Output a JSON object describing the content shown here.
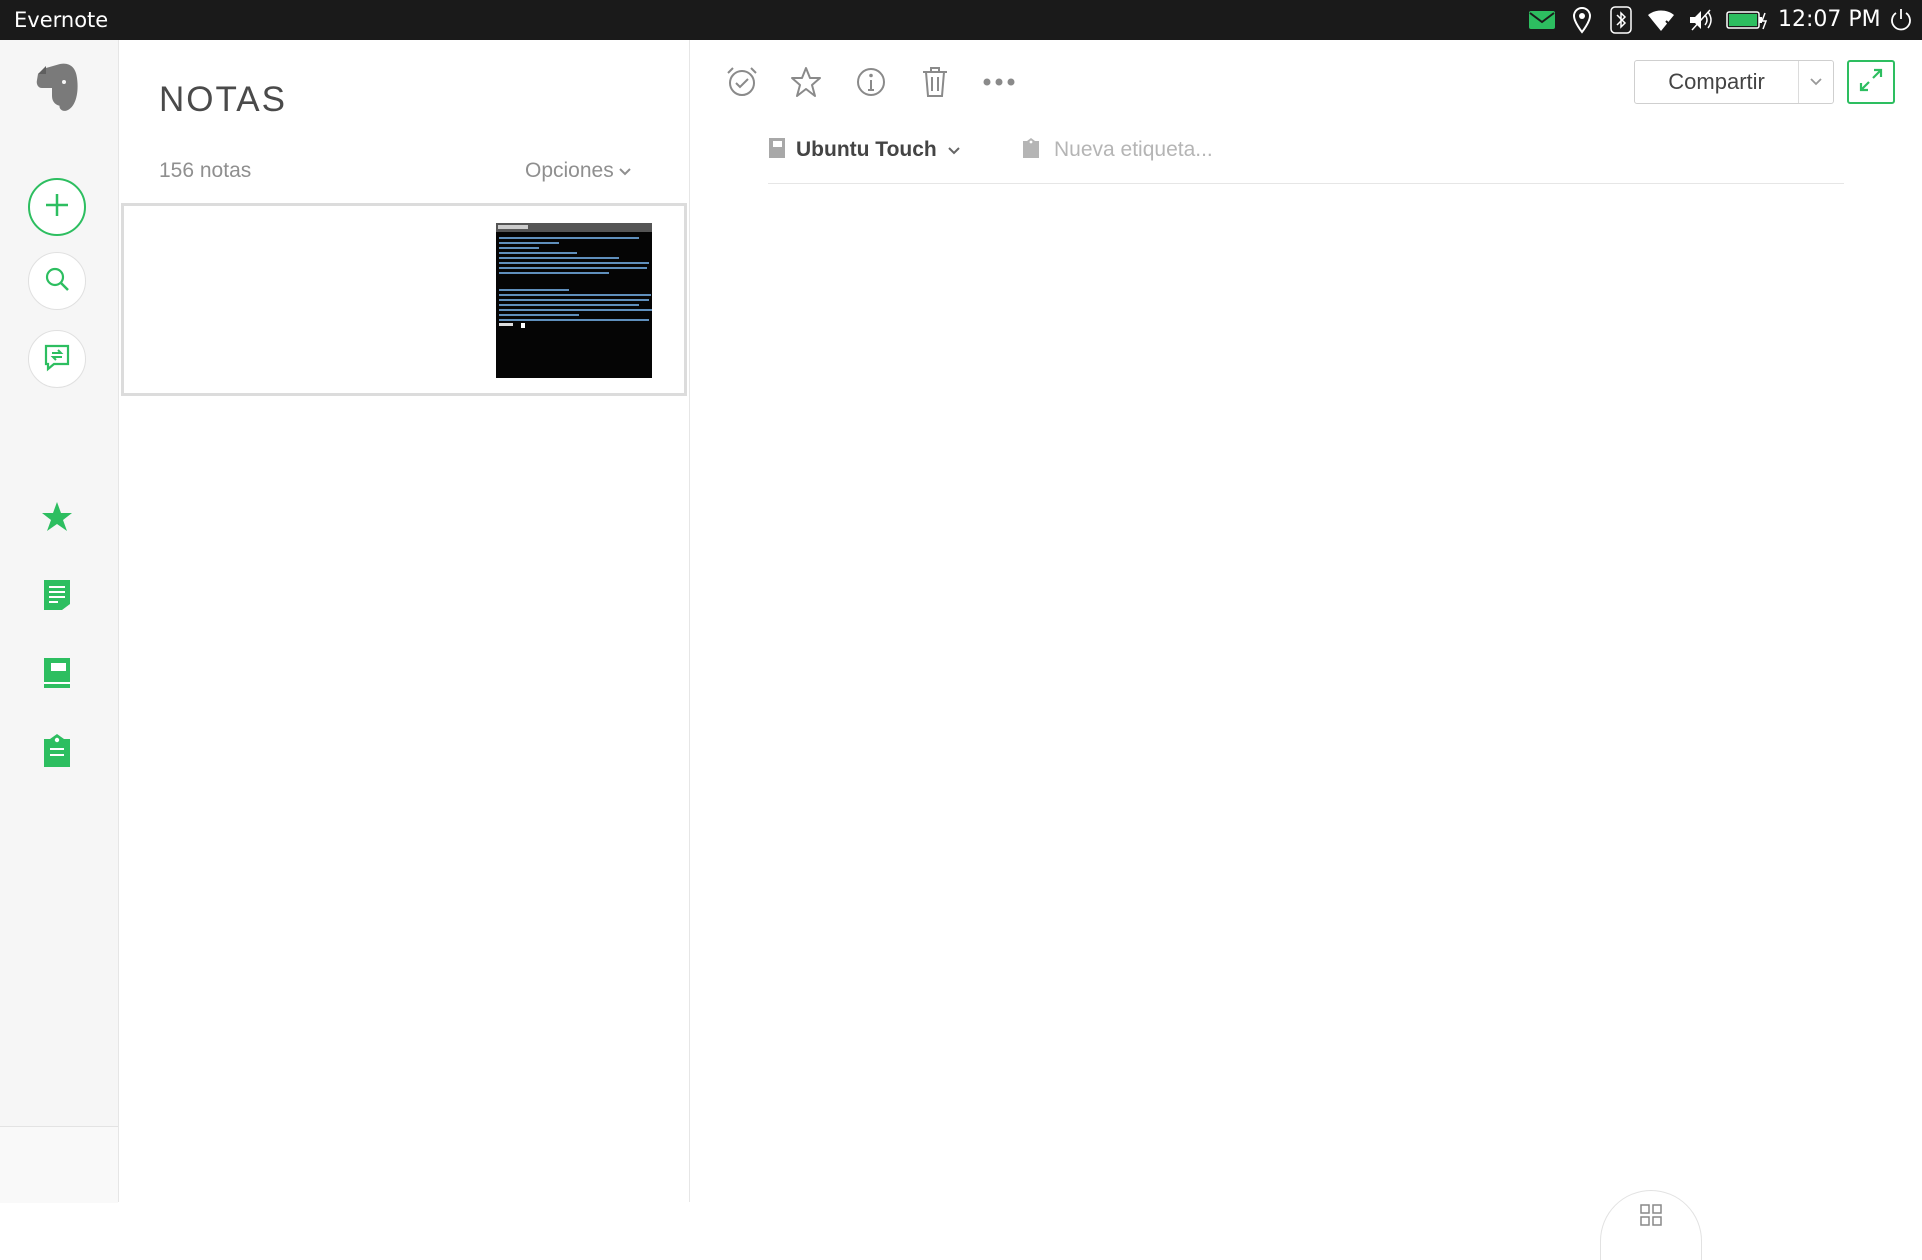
{
  "system_bar": {
    "app_title": "Evernote",
    "time": "12:07 PM",
    "indicators": [
      "mail-icon",
      "location-icon",
      "bluetooth-icon",
      "wifi-icon",
      "volume-muted-icon",
      "battery-charging-icon",
      "power-icon"
    ],
    "mail_color": "#2dbe60"
  },
  "rail": {
    "logo": "evernote-elephant-icon",
    "buttons": [
      "new-note-icon",
      "search-icon",
      "work-chat-icon"
    ],
    "nav": [
      "shortcuts-star-icon",
      "notes-icon",
      "notebooks-icon",
      "tags-icon"
    ],
    "accent": "#2dbe60"
  },
  "note_list": {
    "title": "NOTAS",
    "count": "156 notas",
    "options_label": "Opciones",
    "notes": [
      {
        "thumbnail": "terminal-screenshot-thumbnail"
      }
    ]
  },
  "editor": {
    "toolbar": [
      "reminder-icon",
      "favorite-star-icon",
      "info-icon",
      "trash-icon",
      "more-icon"
    ],
    "share_label": "Compartir",
    "notebook_name": "Ubuntu Touch",
    "tag_placeholder": "Nueva etiqueta..."
  }
}
